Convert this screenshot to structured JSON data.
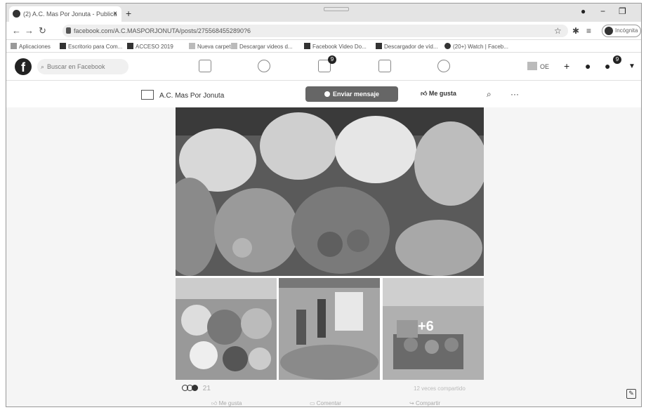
{
  "browser": {
    "tab_title": "(2) A.C. Mas Por Jonuta - Publica",
    "tab_close": "×",
    "new_tab": "+",
    "url": "facebook.com/A.C.MASPORJONUTA/posts/2755684552890?6",
    "incognito_label": "Incógnita"
  },
  "bookmarks": [
    {
      "label": "Aplicaciones"
    },
    {
      "label": "Escritorio para Com..."
    },
    {
      "label": "ACCESO 2019"
    },
    {
      "label": "Nueva carpeta"
    },
    {
      "label": "Descargar videos d..."
    },
    {
      "label": "Facebook Video Do..."
    },
    {
      "label": "Descargador de víd..."
    },
    {
      "label": "(20+) Watch | Faceb..."
    }
  ],
  "facebook": {
    "logo": "f",
    "search_placeholder": "Buscar en Facebook",
    "nav_badge": "9",
    "profile_short": "OE",
    "notif_badge": "9"
  },
  "page": {
    "name": "A.C. Mas Por Jonuta",
    "send_message": "Enviar mensaje",
    "like": "Me gusta",
    "more": "···"
  },
  "photos": {
    "more_count": "+6"
  },
  "post_footer": {
    "reaction_count": "21",
    "stats": "12 veces compartido",
    "actions": [
      "Me gusta",
      "Comentar",
      "Compartir"
    ]
  }
}
